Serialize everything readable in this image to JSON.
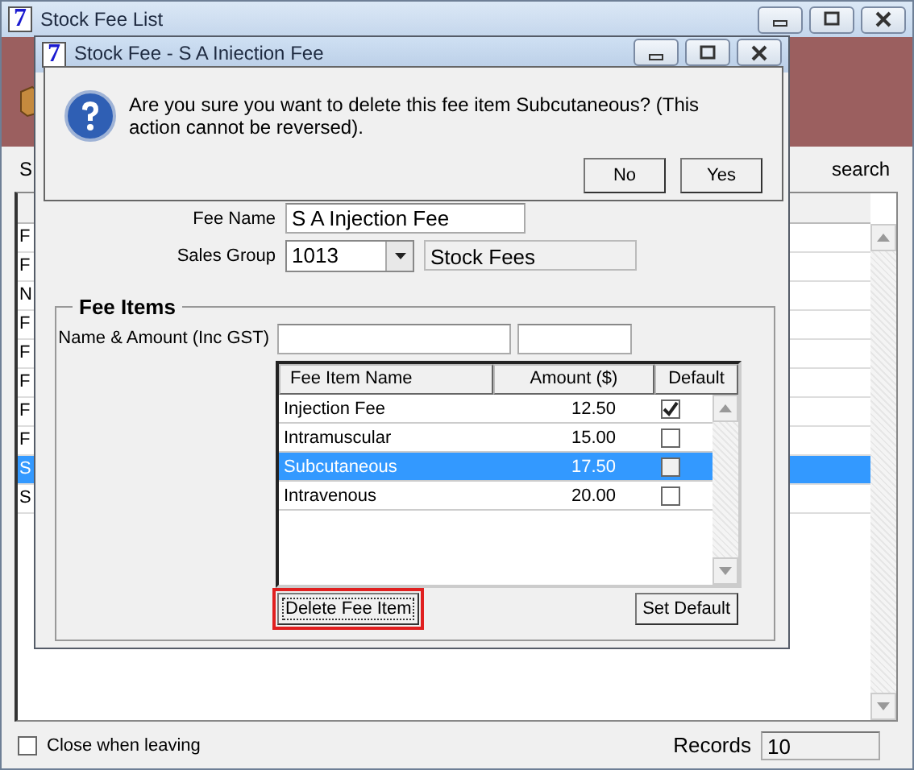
{
  "main_window": {
    "app_icon": "7",
    "title": "Stock Fee List",
    "toolbar_left": "S",
    "toolbar_right": "search",
    "list_rows": [
      {
        "text": "F",
        "selected": false
      },
      {
        "text": "F",
        "selected": false
      },
      {
        "text": "N",
        "selected": false
      },
      {
        "text": "F",
        "selected": false
      },
      {
        "text": "F",
        "selected": false
      },
      {
        "text": "F",
        "selected": false
      },
      {
        "text": "F",
        "selected": false
      },
      {
        "text": "F",
        "selected": false
      },
      {
        "text": "S",
        "selected": true
      },
      {
        "text": "S",
        "selected": false
      }
    ],
    "close_when_leaving": {
      "label": "Close when leaving",
      "checked": false
    },
    "records": {
      "label": "Records",
      "value": "10"
    }
  },
  "fee_window": {
    "app_icon": "7",
    "title": "Stock Fee - S A Iniection Fee",
    "fee_name": {
      "label": "Fee Name",
      "value": "S A Injection Fee"
    },
    "sales_group": {
      "label": "Sales Group",
      "value": "1013",
      "description": "Stock Fees"
    },
    "fee_items": {
      "title": "Fee Items",
      "name_amount_label": "Name & Amount (Inc GST)",
      "columns": [
        "Fee Item Name",
        "Amount ($)",
        "Default"
      ],
      "rows": [
        {
          "name": "Injection Fee",
          "amount": "12.50",
          "default": true,
          "selected": false
        },
        {
          "name": "Intramuscular",
          "amount": "15.00",
          "default": false,
          "selected": false
        },
        {
          "name": "Subcutaneous",
          "amount": "17.50",
          "default": false,
          "selected": true
        },
        {
          "name": "Intravenous",
          "amount": "20.00",
          "default": false,
          "selected": false
        }
      ],
      "buttons": [
        {
          "label": "Delete Fee Item",
          "highlighted": true
        },
        {
          "label": "Set Default",
          "highlighted": false
        }
      ]
    }
  },
  "dialog": {
    "message": "Are you sure you want to delete this fee item Subcutaneous? (This action cannot be reversed).",
    "buttons": [
      "No",
      "Yes"
    ]
  }
}
